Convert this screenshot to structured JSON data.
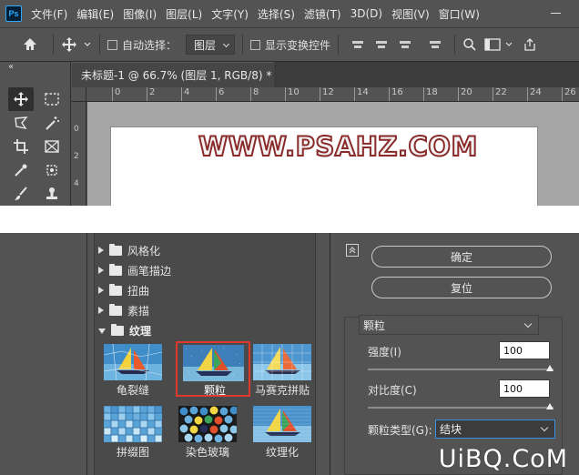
{
  "menubar": {
    "logo": "Ps",
    "items": [
      "文件(F)",
      "编辑(E)",
      "图像(I)",
      "图层(L)",
      "文字(Y)",
      "选择(S)",
      "滤镜(T)",
      "3D(D)",
      "视图(V)",
      "窗口(W)"
    ]
  },
  "optbar": {
    "auto_select_label": "自动选择：",
    "layer_select_value": "图层",
    "show_transform_label": "显示变换控件"
  },
  "toolpanel": {
    "collapse": "«"
  },
  "document": {
    "tab_title": "未标题-1 @ 66.7% (图层 1, RGB/8) *",
    "tab_close": "×",
    "ruler_h_ticks": [
      "0",
      "2",
      "4",
      "6",
      "8",
      "10",
      "12",
      "14",
      "16",
      "18",
      "20",
      "22",
      "24",
      "26"
    ],
    "ruler_v_ticks": [
      "0",
      "2",
      "4",
      "6"
    ],
    "canvas_text": "WWW.PSAHZ.COM",
    "text_stroke_color": "#8a2a2a"
  },
  "filter_gallery": {
    "categories": [
      {
        "label": "风格化",
        "expanded": false
      },
      {
        "label": "画笔描边",
        "expanded": false
      },
      {
        "label": "扭曲",
        "expanded": false
      },
      {
        "label": "素描",
        "expanded": false
      },
      {
        "label": "纹理",
        "expanded": true
      }
    ],
    "thumbnails": [
      {
        "label": "龟裂缝",
        "selected": false
      },
      {
        "label": "颗粒",
        "selected": true
      },
      {
        "label": "马赛克拼贴",
        "selected": false
      },
      {
        "label": "拼缀图",
        "selected": false
      },
      {
        "label": "染色玻璃",
        "selected": false
      },
      {
        "label": "纹理化",
        "selected": false
      }
    ],
    "selection_color": "#e03a2e"
  },
  "settings": {
    "collapse_icon": "chevron-up-icon",
    "ok_label": "确定",
    "reset_label": "复位",
    "filter_select_value": "颗粒",
    "intensity_label": "强度(I)",
    "intensity_value": "100",
    "intensity_level": 1.0,
    "contrast_label": "对比度(C)",
    "contrast_value": "100",
    "contrast_level": 1.0,
    "grain_type_label": "颗粒类型(G):",
    "grain_type_value": "结块"
  },
  "site_watermark": "UiBQ.CoM"
}
